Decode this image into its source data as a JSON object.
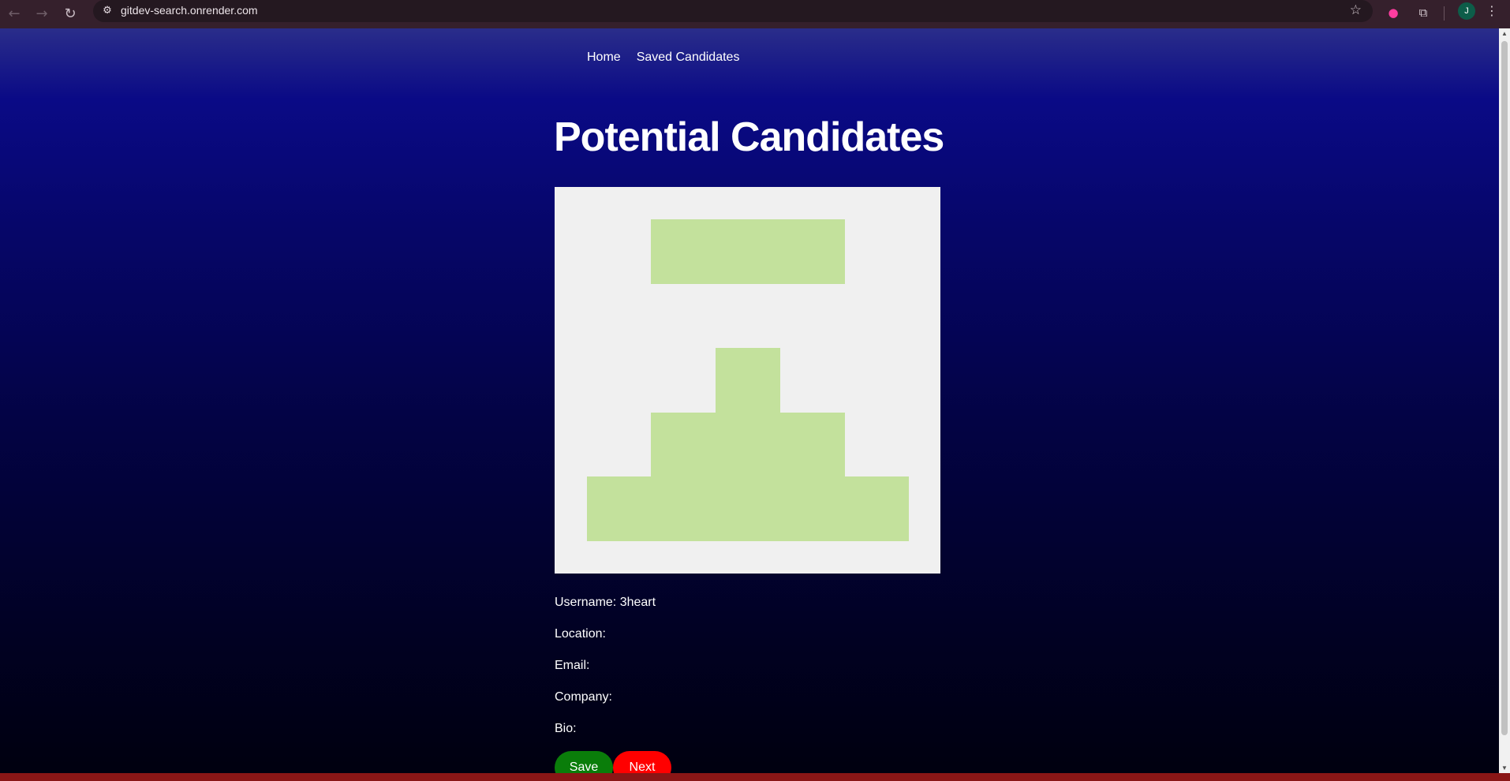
{
  "browser": {
    "url": "gitdev-search.onrender.com",
    "profile_initial": "J"
  },
  "nav": {
    "home_label": "Home",
    "saved_label": "Saved Candidates"
  },
  "main": {
    "title": "Potential Candidates",
    "avatar_color": "#c3e19c",
    "avatar_bg": "#f0f0f0",
    "fields": [
      {
        "label": "Username:",
        "value": "3heart"
      },
      {
        "label": "Location:",
        "value": ""
      },
      {
        "label": "Email:",
        "value": ""
      },
      {
        "label": "Company:",
        "value": ""
      },
      {
        "label": "Bio:",
        "value": ""
      }
    ],
    "buttons": {
      "save_label": "Save",
      "next_label": "Next"
    }
  },
  "colors": {
    "save": "#0a7d0a",
    "next": "#ff0000"
  }
}
